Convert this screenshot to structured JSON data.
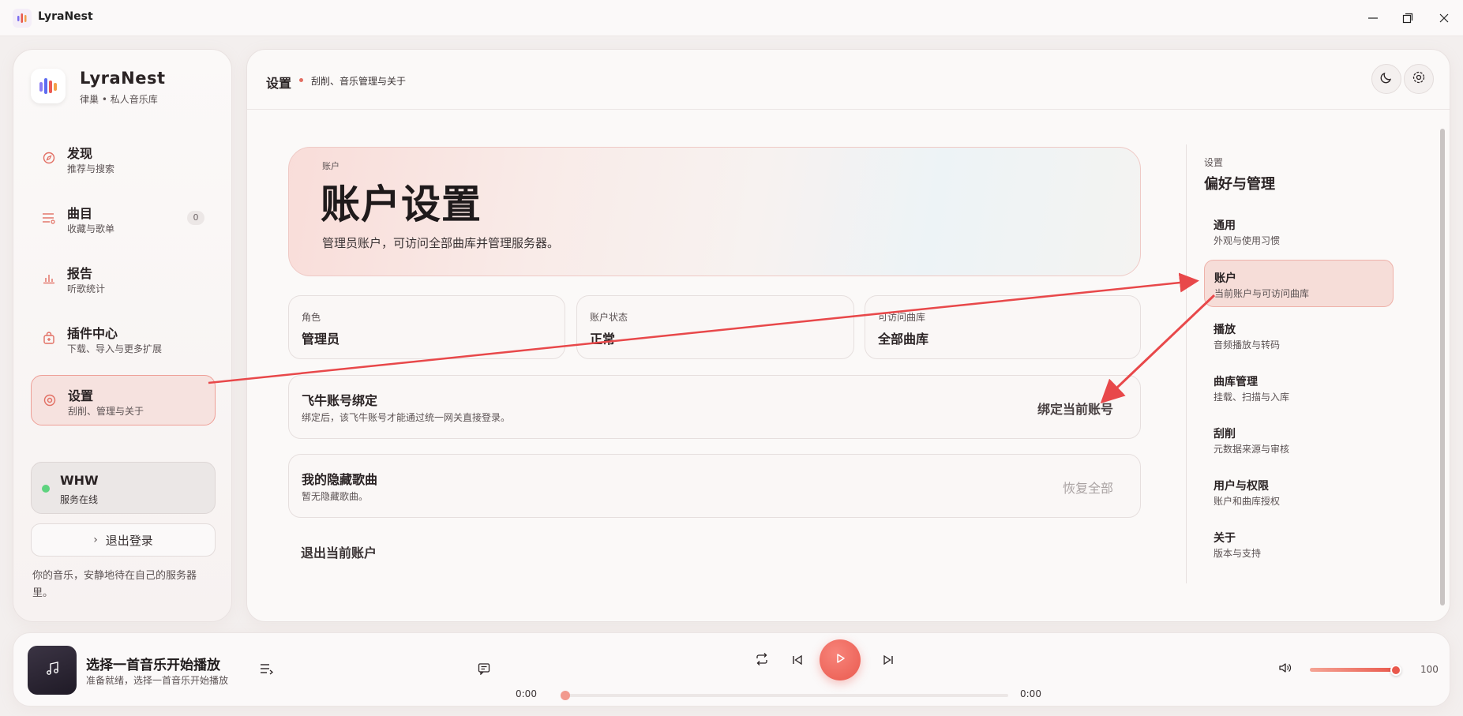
{
  "window": {
    "title": "LyraNest"
  },
  "brand": {
    "name": "LyraNest",
    "subtitle": "律巢 • 私人音乐库"
  },
  "sidebar": {
    "items": [
      {
        "title": "发现",
        "subtitle": "推荐与搜索",
        "icon": "compass-icon"
      },
      {
        "title": "曲目",
        "subtitle": "收藏与歌单",
        "icon": "list-icon",
        "badge": "0"
      },
      {
        "title": "报告",
        "subtitle": "听歌统计",
        "icon": "bar-chart-icon"
      },
      {
        "title": "插件中心",
        "subtitle": "下载、导入与更多扩展",
        "icon": "plugin-icon"
      },
      {
        "title": "设置",
        "subtitle": "刮削、管理与关于",
        "icon": "settings-icon",
        "active": true
      }
    ],
    "server": {
      "name": "WHW",
      "status": "服务在线",
      "status_color": "#5ed37f"
    },
    "logout_label": "退出登录",
    "tagline": "你的音乐，安静地待在自己的服务器里。"
  },
  "header": {
    "title": "设置",
    "subtitle": "刮削、音乐管理与关于"
  },
  "hero": {
    "kicker": "账户",
    "title": "账户设置",
    "description": "管理员账户，可访问全部曲库并管理服务器。"
  },
  "info_cards": [
    {
      "label": "角色",
      "value": "管理员"
    },
    {
      "label": "账户状态",
      "value": "正常"
    },
    {
      "label": "可访问曲库",
      "value": "全部曲库"
    }
  ],
  "feiniu": {
    "title": "飞牛账号绑定",
    "subtitle": "绑定后，该飞牛账号才能通过统一网关直接登录。",
    "action": "绑定当前账号"
  },
  "hidden_songs": {
    "title": "我的隐藏歌曲",
    "subtitle": "暂无隐藏歌曲。",
    "action": "恢复全部"
  },
  "logout_account_label": "退出当前账户",
  "settings_nav": {
    "kicker": "设置",
    "title": "偏好与管理",
    "items": [
      {
        "title": "通用",
        "subtitle": "外观与使用习惯"
      },
      {
        "title": "账户",
        "subtitle": "当前账户与可访问曲库",
        "active": true
      },
      {
        "title": "播放",
        "subtitle": "音频播放与转码"
      },
      {
        "title": "曲库管理",
        "subtitle": "挂载、扫描与入库"
      },
      {
        "title": "刮削",
        "subtitle": "元数据来源与审核"
      },
      {
        "title": "用户与权限",
        "subtitle": "账户和曲库授权"
      },
      {
        "title": "关于",
        "subtitle": "版本与支持"
      }
    ]
  },
  "player": {
    "track_title": "选择一首音乐开始播放",
    "track_subtitle": "准备就绪，选择一首音乐开始播放",
    "current_time": "0:00",
    "total_time": "0:00",
    "progress": 0,
    "volume": 100,
    "volume_label": "100"
  },
  "colors": {
    "accent": "#ea5a4f",
    "annotation_arrow": "#e8484a"
  }
}
